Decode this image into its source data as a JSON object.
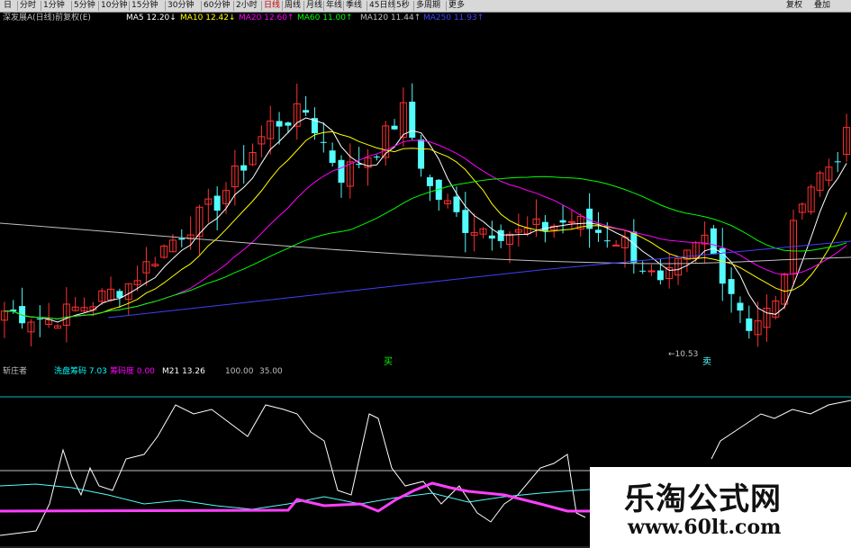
{
  "toolbar": {
    "tabs": [
      {
        "label": "日",
        "active": false
      },
      {
        "label": "分时",
        "active": false
      },
      {
        "label": "1分钟",
        "active": false
      },
      {
        "label": "5分钟",
        "active": false
      },
      {
        "label": "10分钟",
        "active": false
      },
      {
        "label": "15分钟",
        "active": false
      },
      {
        "label": "30分钟",
        "active": false
      },
      {
        "label": "60分钟",
        "active": false
      },
      {
        "label": "2小时",
        "active": false
      },
      {
        "label": "日线",
        "active": true
      },
      {
        "label": "周线",
        "active": false
      },
      {
        "label": "月线",
        "active": false
      },
      {
        "label": "年线",
        "active": false
      },
      {
        "label": "季线",
        "active": false
      },
      {
        "label": "45日线",
        "active": false
      },
      {
        "label": "5秒",
        "active": false
      },
      {
        "label": "多周期",
        "active": false
      },
      {
        "label": "更多",
        "active": false
      }
    ],
    "right_buttons": [
      "复权",
      "叠加"
    ]
  },
  "main_indicator": {
    "name": "深发展A(日线)前复权(E)",
    "items": [
      {
        "label": "MA5",
        "value": "12.20",
        "arrow": "↓",
        "color": "#ffffff"
      },
      {
        "label": "MA10",
        "value": "12.42",
        "arrow": "↓",
        "color": "#ffff00"
      },
      {
        "label": "MA20",
        "value": "12.60",
        "arrow": "↑",
        "color": "#ff00ff"
      },
      {
        "label": "MA60",
        "value": "11.00",
        "arrow": "↑",
        "color": "#00ff00"
      },
      {
        "label": "MA120",
        "value": "11.44",
        "arrow": "↑",
        "color": "#c0c0c0"
      },
      {
        "label": "MA250",
        "value": "11.93",
        "arrow": "↑",
        "color": "#4040ff"
      }
    ],
    "low_marker": "10.53",
    "signal_labels": [
      {
        "text": "买"
      },
      {
        "text": "卖"
      }
    ]
  },
  "sub_indicator": {
    "name": "斩庄者",
    "items": [
      {
        "label": "洗盘筹码",
        "value": "7.03",
        "color": "#00ffff"
      },
      {
        "label": "筹码度",
        "value": "0.00",
        "color": "#ff00ff"
      },
      {
        "label": "M21",
        "value": "13.26",
        "color": "#ffffff"
      },
      {
        "label": "",
        "value": "100.00",
        "color": "#c0c0c0"
      },
      {
        "label": "",
        "value": "35.00",
        "color": "#c0c0c0"
      }
    ]
  },
  "colors": {
    "up": "#ff3030",
    "down": "#54fcfc",
    "ma5": "#ffffff",
    "ma10": "#ffff00",
    "ma20": "#ff00ff",
    "ma60": "#00ff00",
    "ma120": "#c0c0c0",
    "ma250": "#4040ff",
    "sub_white": "#ffffff",
    "sub_cyan": "#54fcfc",
    "sub_magenta": "#ff40ff",
    "top_ref": "#00c0c0",
    "mid_ref": "#c0c0c0"
  },
  "watermark": {
    "title": "乐淘公式网",
    "url": "www.60lt.com"
  }
}
